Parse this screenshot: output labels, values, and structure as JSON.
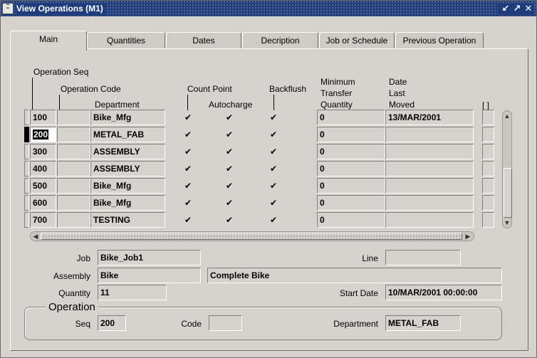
{
  "window": {
    "title": "View Operations (M1)",
    "icon_label": "ORACLE"
  },
  "tabs": [
    "Main",
    "Quantities",
    "Dates",
    "Decription",
    "Job or Schedule",
    "Previous Operation"
  ],
  "active_tab": "Main",
  "headers": {
    "op_seq": "Operation Seq",
    "op_code": "Operation Code",
    "department": "Department",
    "count_point": "Count Point",
    "autocharge": "Autocharge",
    "backflush": "Backflush",
    "min_transfer_1": "Minimum",
    "min_transfer_2": "Transfer",
    "min_transfer_3": "Quantity",
    "date_moved_1": "Date",
    "date_moved_2": "Last",
    "date_moved_3": "Moved",
    "extra": "[ ]"
  },
  "rows": [
    {
      "seq": "100",
      "code": "",
      "dept": "Bike_Mfg",
      "count_point": true,
      "autocharge": true,
      "backflush": true,
      "min_qty": "0",
      "date_moved": "13/MAR/2001"
    },
    {
      "seq": "200",
      "code": "",
      "dept": "METAL_FAB",
      "count_point": true,
      "autocharge": true,
      "backflush": true,
      "min_qty": "0",
      "date_moved": ""
    },
    {
      "seq": "300",
      "code": "",
      "dept": "ASSEMBLY",
      "count_point": true,
      "autocharge": true,
      "backflush": true,
      "min_qty": "0",
      "date_moved": ""
    },
    {
      "seq": "400",
      "code": "",
      "dept": "ASSEMBLY",
      "count_point": true,
      "autocharge": true,
      "backflush": true,
      "min_qty": "0",
      "date_moved": ""
    },
    {
      "seq": "500",
      "code": "",
      "dept": "Bike_Mfg",
      "count_point": true,
      "autocharge": true,
      "backflush": true,
      "min_qty": "0",
      "date_moved": ""
    },
    {
      "seq": "600",
      "code": "",
      "dept": "Bike_Mfg",
      "count_point": true,
      "autocharge": true,
      "backflush": true,
      "min_qty": "0",
      "date_moved": ""
    },
    {
      "seq": "700",
      "code": "",
      "dept": "TESTING",
      "count_point": true,
      "autocharge": true,
      "backflush": true,
      "min_qty": "0",
      "date_moved": ""
    }
  ],
  "current_row": 1,
  "checkbox_glyph": "✔",
  "details": {
    "job_label": "Job",
    "job_value": "Bike_Job1",
    "line_label": "Line",
    "line_value": "",
    "assembly_label": "Assembly",
    "assembly_value": "Bike",
    "assembly_desc": "Complete Bike",
    "quantity_label": "Quantity",
    "quantity_value": "11",
    "start_date_label": "Start Date",
    "start_date_value": "10/MAR/2001 00:00:00"
  },
  "operation": {
    "legend": "Operation",
    "seq_label": "Seq",
    "seq_value": "200",
    "code_label": "Code",
    "code_value": "",
    "dept_label": "Department",
    "dept_value": "METAL_FAB"
  }
}
